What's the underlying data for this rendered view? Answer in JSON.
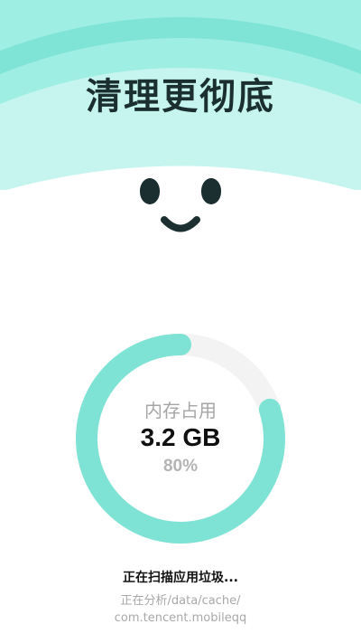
{
  "header": {
    "title": "清理更彻底"
  },
  "memory": {
    "label": "内存占用",
    "value": "3.2 GB",
    "percent_text": "80%",
    "usage_fraction": 0.8
  },
  "scan": {
    "status": "正在扫描应用垃圾...",
    "path_line1": "正在分析/data/cache/",
    "path_line2": "com.tencent.mobileqq"
  },
  "colors": {
    "accent": "#7ee3d5",
    "track": "#f3f3f3",
    "header_light": "#c6f5ef",
    "header_mid": "#9eeee3",
    "header_dark": "#7fe3d6",
    "face": "#1b2f30"
  },
  "icons": {
    "face": "smiley-face-icon"
  }
}
